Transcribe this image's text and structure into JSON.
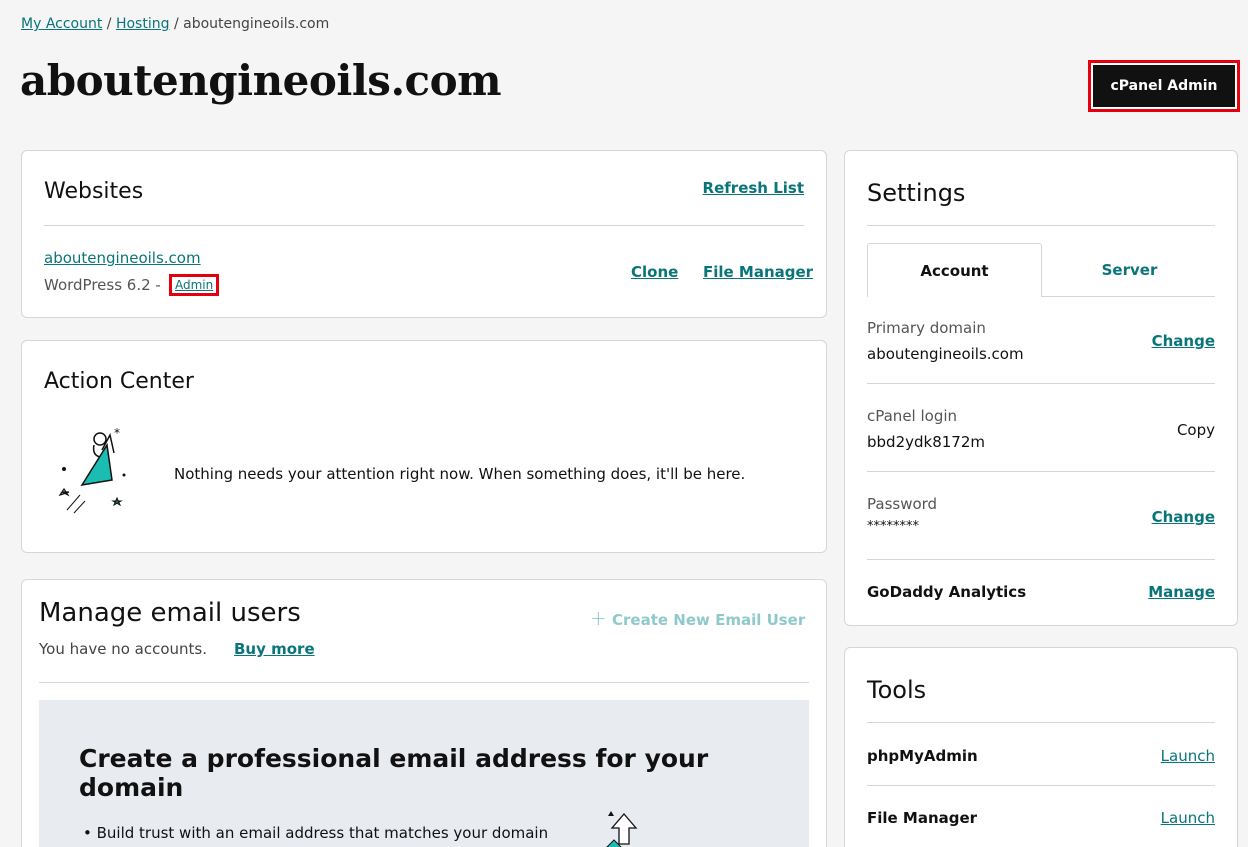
{
  "breadcrumb": {
    "my_account": "My Account",
    "sep1": "/",
    "hosting": "Hosting",
    "sep2": "/",
    "current": "aboutengineoils.com"
  },
  "page": {
    "title": "aboutengineoils.com",
    "cpanel_button": "cPanel Admin"
  },
  "websites": {
    "title": "Websites",
    "refresh": "Refresh List",
    "site": {
      "domain": "aboutengineoils.com",
      "version": "WordPress 6.2 - ",
      "admin": "Admin",
      "clone": "Clone",
      "file_manager": "File Manager"
    }
  },
  "action_center": {
    "title": "Action Center",
    "message": "Nothing needs your attention right now. When something does, it'll be here."
  },
  "email": {
    "title": "Manage email users",
    "create": "Create New Email User",
    "no_accounts": "You have no accounts.",
    "buy_more": "Buy more",
    "promo_title": "Create a professional email address for your domain",
    "bullet": "• Build trust with an email address that matches your domain"
  },
  "settings": {
    "title": "Settings",
    "tabs": {
      "account": "Account",
      "server": "Server"
    },
    "rows": [
      {
        "label": "Primary domain",
        "value": "aboutengineoils.com",
        "action": "Change"
      },
      {
        "label": "cPanel login",
        "value": "bbd2ydk8172m",
        "action": "Copy"
      },
      {
        "label": "Password",
        "value": "********",
        "action": "Change"
      },
      {
        "label": "GoDaddy Analytics",
        "action": "Manage"
      }
    ]
  },
  "tools": {
    "title": "Tools",
    "items": [
      {
        "name": "phpMyAdmin",
        "action": "Launch"
      },
      {
        "name": "File Manager",
        "action": "Launch"
      }
    ]
  },
  "colors": {
    "link": "#09757a",
    "highlight": "#e4000f",
    "button_bg": "#111111"
  }
}
